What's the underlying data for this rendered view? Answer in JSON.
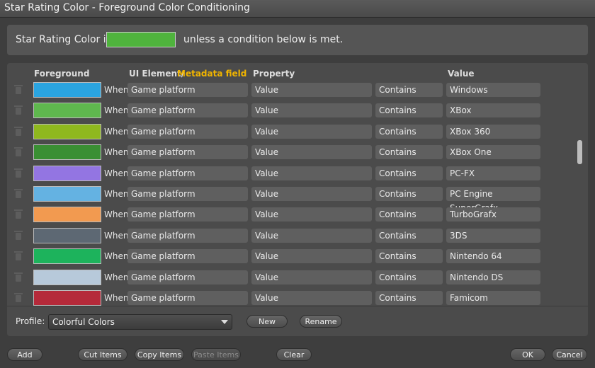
{
  "window": {
    "title": "Star Rating Color - Foreground Color Conditioning"
  },
  "top": {
    "prefix": "Star Rating Color is",
    "suffix": "unless a condition below is met.",
    "color": "#4fb33d"
  },
  "headers": {
    "foreground": "Foreground",
    "ui_element": "UI Element",
    "slash": "/",
    "metadata_field": "Metadata field",
    "property": "Property",
    "value": "Value"
  },
  "rows": [
    {
      "color": "#2aa4e0",
      "when": "When",
      "element": "Game platform",
      "property": "Value",
      "op": "Contains",
      "value": "Windows"
    },
    {
      "color": "#5fb84e",
      "when": "When",
      "element": "Game platform",
      "property": "Value",
      "op": "Contains",
      "value": "XBox"
    },
    {
      "color": "#8fb81e",
      "when": "When",
      "element": "Game platform",
      "property": "Value",
      "op": "Contains",
      "value": "XBox 360"
    },
    {
      "color": "#3a8f33",
      "when": "When",
      "element": "Game platform",
      "property": "Value",
      "op": "Contains",
      "value": "XBox One"
    },
    {
      "color": "#9375e2",
      "when": "When",
      "element": "Game platform",
      "property": "Value",
      "op": "Contains",
      "value": "PC-FX"
    },
    {
      "color": "#64b2e2",
      "when": "When",
      "element": "Game platform",
      "property": "Value",
      "op": "Contains",
      "value": "PC Engine SuperGrafx"
    },
    {
      "color": "#f29a50",
      "when": "When",
      "element": "Game platform",
      "property": "Value",
      "op": "Contains",
      "value": "TurboGrafx"
    },
    {
      "color": "#5d6873",
      "when": "When",
      "element": "Game platform",
      "property": "Value",
      "op": "Contains",
      "value": "3DS"
    },
    {
      "color": "#1db35c",
      "when": "When",
      "element": "Game platform",
      "property": "Value",
      "op": "Contains",
      "value": "Nintendo 64"
    },
    {
      "color": "#b7c9da",
      "when": "When",
      "element": "Game platform",
      "property": "Value",
      "op": "Contains",
      "value": "Nintendo DS"
    },
    {
      "color": "#b52a3a",
      "when": "When",
      "element": "Game platform",
      "property": "Value",
      "op": "Contains",
      "value": "Famicom"
    }
  ],
  "profile": {
    "label": "Profile:",
    "value": "Colorful Colors"
  },
  "buttons": {
    "new": "New",
    "rename": "Rename",
    "add": "Add",
    "cut": "Cut Items",
    "copy": "Copy Items",
    "paste": "Paste Items",
    "clear": "Clear",
    "ok": "OK",
    "cancel": "Cancel"
  }
}
